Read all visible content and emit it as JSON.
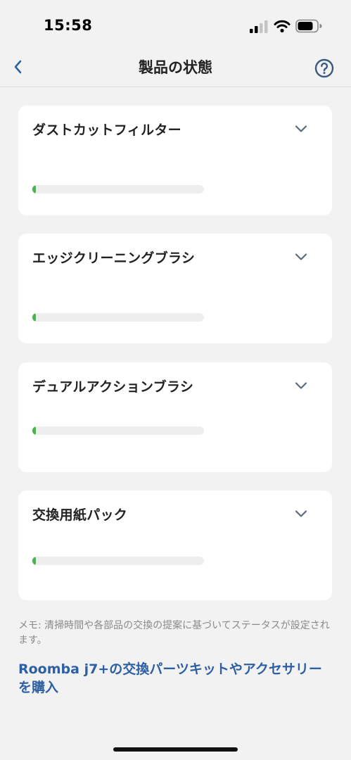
{
  "status_bar": {
    "time": "15:58",
    "signal_icon": "cellular-signal-icon",
    "wifi_icon": "wifi-icon",
    "battery_icon": "battery-icon"
  },
  "nav": {
    "back_icon": "chevron-left-icon",
    "title": "製品の状態",
    "help_icon": "question-circle-icon"
  },
  "colors": {
    "accent": "#2d5fa3",
    "progress": "#4caf50",
    "background": "#f2f2f2",
    "card": "#ffffff"
  },
  "cards": [
    {
      "title": "ダストカットフィルター",
      "progress_percent": 2,
      "chevron_icon": "chevron-down-icon"
    },
    {
      "title": "エッジクリーニングブラシ",
      "progress_percent": 2,
      "chevron_icon": "chevron-down-icon"
    },
    {
      "title": "デュアルアクションブラシ",
      "progress_percent": 2,
      "chevron_icon": "chevron-down-icon"
    },
    {
      "title": "交換用紙パック",
      "progress_percent": 2,
      "chevron_icon": "chevron-down-icon"
    }
  ],
  "memo": "メモ: 清掃時間や各部品の交換の提案に基づいてステータスが設定されます。",
  "purchase_link": "Roomba j7+の交換パーツキットやアクセサリーを購入"
}
